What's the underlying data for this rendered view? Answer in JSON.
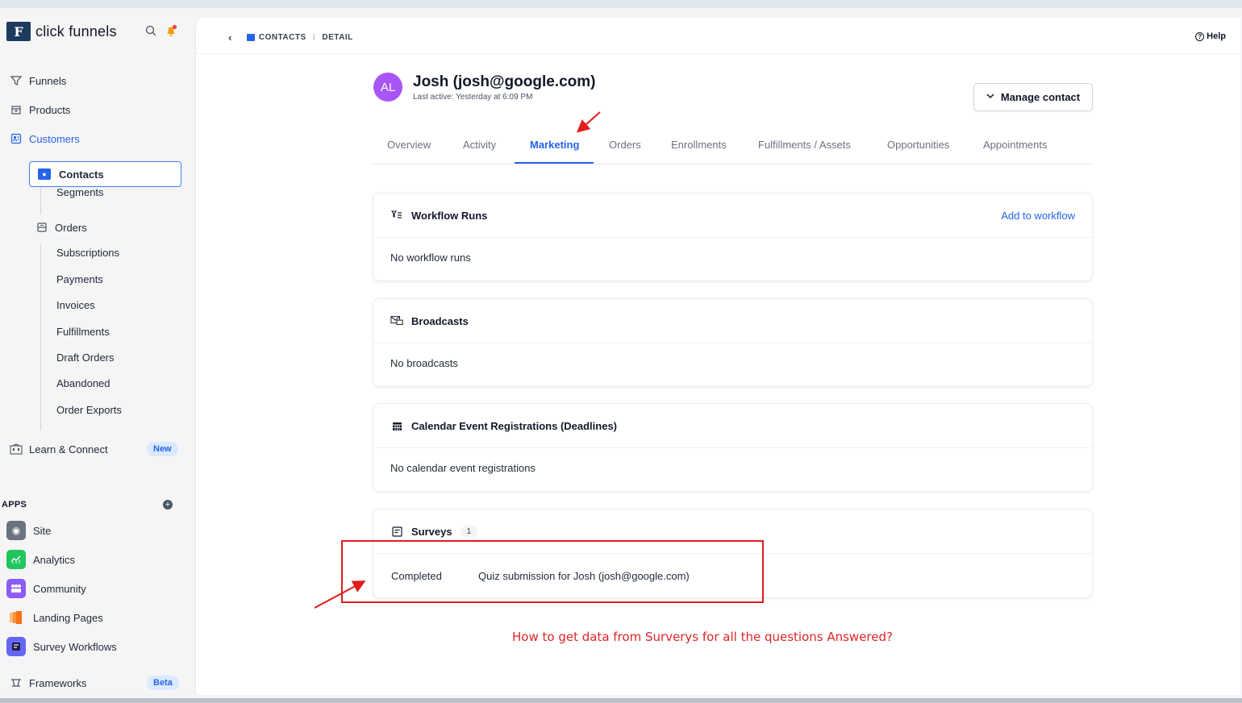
{
  "app": {
    "logo_text": "click funnels",
    "logo_mark": "F"
  },
  "sidebar": {
    "nav": [
      {
        "label": "Funnels",
        "icon": "funnel-icon"
      },
      {
        "label": "Products",
        "icon": "box-icon"
      },
      {
        "label": "Customers",
        "icon": "customers-icon"
      }
    ],
    "contacts_label": "Contacts",
    "segments_label": "Segments",
    "orders_label": "Orders",
    "order_subitems": [
      "Subscriptions",
      "Payments",
      "Invoices",
      "Fulfillments",
      "Draft Orders",
      "Abandoned",
      "Order Exports"
    ],
    "learn_label": "Learn & Connect",
    "learn_badge": "New",
    "apps_label": "APPS",
    "apps": [
      {
        "label": "Site",
        "icon": "globe-icon",
        "color": "#6b7280"
      },
      {
        "label": "Analytics",
        "icon": "chart-icon",
        "color": "#22c55e"
      },
      {
        "label": "Community",
        "icon": "people-icon",
        "color": "#8b5cf6"
      },
      {
        "label": "Landing Pages",
        "icon": "pages-icon",
        "color": "#f97316"
      },
      {
        "label": "Survey Workflows",
        "icon": "survey-icon",
        "color": "#6366f1"
      }
    ],
    "frameworks_label": "Frameworks",
    "frameworks_badge": "Beta"
  },
  "breadcrumb": {
    "section": "CONTACTS",
    "page": "DETAIL"
  },
  "help_label": "Help",
  "contact": {
    "initials": "AL",
    "name": "Josh (josh@google.com)",
    "last_active": "Last active: Yesterday at 6:09 PM",
    "manage_label": "Manage contact"
  },
  "tabs": [
    "Overview",
    "Activity",
    "Marketing",
    "Orders",
    "Enrollments",
    "Fulfillments / Assets",
    "Opportunities",
    "Appointments"
  ],
  "active_tab": "Marketing",
  "cards": {
    "workflow": {
      "title": "Workflow Runs",
      "action": "Add to workflow",
      "empty": "No workflow runs"
    },
    "broadcasts": {
      "title": "Broadcasts",
      "empty": "No broadcasts"
    },
    "calendar": {
      "title": "Calendar Event Registrations (Deadlines)",
      "empty": "No calendar event registrations"
    },
    "surveys": {
      "title": "Surveys",
      "count": "1",
      "row_status": "Completed",
      "row_title": "Quiz submission for Josh (josh@google.com)"
    }
  },
  "annotation": {
    "question": "How to get data from Surverys for all the questions Answered?",
    "color": "#e11d1d"
  },
  "colors": {
    "accent": "#2563eb",
    "avatar": "#a855f7"
  }
}
